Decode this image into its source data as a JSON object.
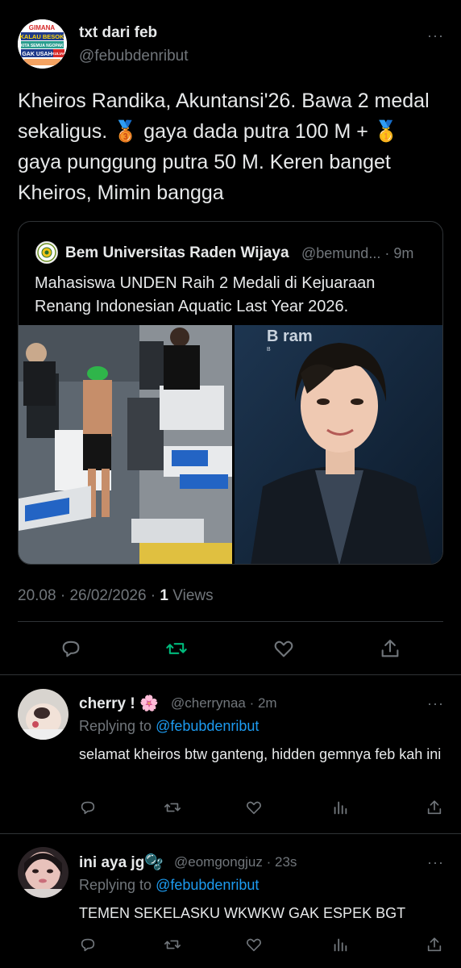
{
  "main_tweet": {
    "display_name": "txt dari feb",
    "handle": "@febubdenribut",
    "avatar_text": [
      "GIMANA",
      "KALAU BESOK",
      "KITA SEMUA NGOPAK",
      "GAK USAH",
      "KULIAH"
    ],
    "text": "Kheiros Randika, Akuntansi'26. Bawa 2 medal sekaligus. 🥉 gaya dada putra 100 M + 🥇 gaya punggung putra 50 M. Keren banget Kheiros, Mimin bangga",
    "time": "20.08",
    "separator": " · ",
    "date": "26/02/2026",
    "views_count": "1",
    "views_label": " Views"
  },
  "quote": {
    "display_name": "Bem Universitas Raden Wijaya",
    "handle": "@bemund... · 9m",
    "text": "Mahasiswa UNDEN Raih 2 Medali di Kejuaraan Renang Indonesian Aquatic Last Year 2026.",
    "image_right_text": "B      ram",
    "image_right_sub": "B"
  },
  "replies": [
    {
      "display_name": "cherry ! 🌸",
      "handle": "@cherrynaa · 2m",
      "replying_label": "Replying to ",
      "replying_to": "@febubdenribut",
      "text": "selamat kheiros btw ganteng, hidden gemnya feb kah ini"
    },
    {
      "display_name": "ini aya jg🫧",
      "handle": "@eomgongjuz · 23s",
      "replying_label": "Replying to ",
      "replying_to": "@febubdenribut",
      "text": "TEMEN SEKELASKU WKWKW GAK ESPEK BGT"
    }
  ],
  "more_label": "···",
  "colors": {
    "background": "#000000",
    "text": "#e7e9ea",
    "secondary": "#71767b",
    "link": "#1d9bf0",
    "retweet_active": "#00ba7c",
    "border": "#2f3336"
  }
}
